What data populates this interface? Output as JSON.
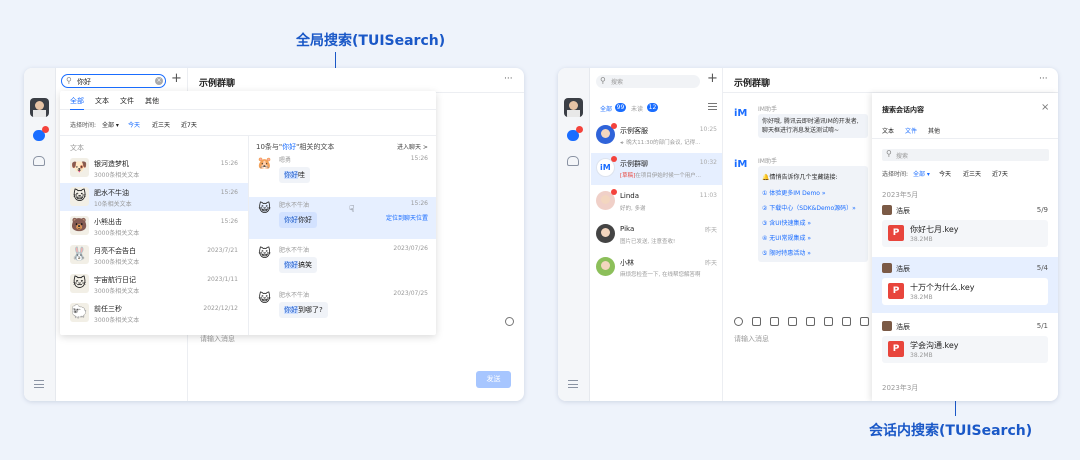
{
  "captions": {
    "top": "全局搜索(TUISearch)",
    "bottom": "会话内搜索(TUISearch)"
  },
  "left": {
    "search": {
      "value": "你好",
      "placeholder": ""
    },
    "title": "示例群聊",
    "more": "···",
    "tabs": [
      "全部",
      "文本",
      "文件",
      "其他"
    ],
    "time": {
      "label": "选择时间:",
      "all": "全部",
      "opts": [
        "今天",
        "近三天",
        "近7天"
      ]
    },
    "section": "文本",
    "results": [
      {
        "name": "银河造梦机",
        "sub": "3000条相关文本",
        "time": "15:26",
        "emoji": "🐶"
      },
      {
        "name": "肥水不牛油",
        "sub": "10条相关文本",
        "time": "15:26",
        "emoji": "😺"
      },
      {
        "name": "小熊出击",
        "sub": "3000条相关文本",
        "time": "15:26",
        "emoji": "🐻"
      },
      {
        "name": "月亮不会告白",
        "sub": "3000条相关文本",
        "time": "2023/7/21",
        "emoji": "🐰"
      },
      {
        "name": "宇宙航行日记",
        "sub": "3000条相关文本",
        "time": "2023/1/11",
        "emoji": "🐱"
      },
      {
        "name": "前任三秒",
        "sub": "3000条相关文本",
        "time": "2022/12/12",
        "emoji": "🐑"
      }
    ],
    "detail": {
      "header": "10条与\"你好\"相关的文本",
      "header_pre": "10条与\"",
      "header_kw": "你好",
      "header_post": "\"相关的文本",
      "enter": "进入聊天 >",
      "msgs": [
        {
          "name": "嗯勇",
          "time": "15:26",
          "text": "你好哇",
          "kw": "你好",
          "rest": "哇",
          "emoji": "🐹",
          "active": false
        },
        {
          "name": "肥水不牛油",
          "time": "15:26",
          "text": "你好你好",
          "kw": "你好",
          "rest": "你好",
          "emoji": "😺",
          "active": true,
          "link": "定位到聊天位置"
        },
        {
          "name": "肥水不牛油",
          "time": "2023/07/26",
          "text": "你好搞笑",
          "kw": "你好",
          "rest": "搞笑",
          "emoji": "😺",
          "active": false
        },
        {
          "name": "肥水不牛油",
          "time": "2023/07/25",
          "text": "你好到哪了?",
          "kw": "你好",
          "rest": "到哪了?",
          "emoji": "😺",
          "active": false
        }
      ]
    },
    "input_placeholder": "请输入消息",
    "send": "发送"
  },
  "right": {
    "search_placeholder": "搜索",
    "filter": {
      "all": "全部",
      "all_count": "99",
      "unread": "未读",
      "unread_count": "12"
    },
    "convs": [
      {
        "name": "示例客服",
        "time": "10:25",
        "msg": "◂· 晚大11:30的部门会议, 记得...",
        "avatar": "face",
        "color": "#2f63d9"
      },
      {
        "name": "示例群聊",
        "time": "10:32",
        "msg": "[草稿] 在项目伊始时候一个用户...",
        "draft": "[草稿]",
        "msg_rest": "在项目伊始时候一个用户...",
        "avatar": "im",
        "color": "#fff",
        "active": true
      },
      {
        "name": "Linda",
        "time": "11:03",
        "msg": "好的, 多谢",
        "avatar": "linda",
        "color": "#f0d0c8"
      },
      {
        "name": "Pika",
        "time": "昨天",
        "msg": "图片已发送, 注意查收!",
        "avatar": "pika",
        "color": "#444"
      },
      {
        "name": "小林",
        "time": "昨天",
        "msg": "麻烦您检查一下, 在线帮您解答啊",
        "avatar": "lin",
        "color": "#8cbf5a"
      }
    ],
    "title": "示例群聊",
    "chat": {
      "bot": "IM助手",
      "msg1": "你好哦, 腾讯云即时通讯IM的开发者,",
      "msg1b": "聊天框进行消息发送测试唷~",
      "bot2": "IM助手",
      "intro": "情悄告诉你几个宝藏链接:",
      "links": [
        "① 体验更多IM Demo »",
        "② 下载中心（SDK&Demo源码）»",
        "③ 含UI快速集成 »",
        "④ 无UI常规集成 »",
        "⑤ 限时特惠活动 »"
      ],
      "input_placeholder": "请输入消息"
    },
    "panel": {
      "title": "搜索会话内容",
      "tabs": [
        "文本",
        "文件",
        "其他"
      ],
      "search_placeholder": "搜索",
      "time": {
        "label": "选择时间:",
        "all": "全部",
        "opts": [
          "今天",
          "近三天",
          "近7天"
        ]
      },
      "date1": "2023年5月",
      "date2": "2023年3月",
      "files": [
        {
          "sender": "浩辰",
          "count": "5/9",
          "file": "你好七月.key",
          "size": "38.2MB"
        },
        {
          "sender": "浩辰",
          "count": "5/4",
          "file": "十万个为什么.key",
          "size": "38.2MB",
          "active": true
        },
        {
          "sender": "浩辰",
          "count": "5/1",
          "file": "学会沟通.key",
          "size": "38.2MB"
        }
      ],
      "file_icon": "P"
    }
  }
}
